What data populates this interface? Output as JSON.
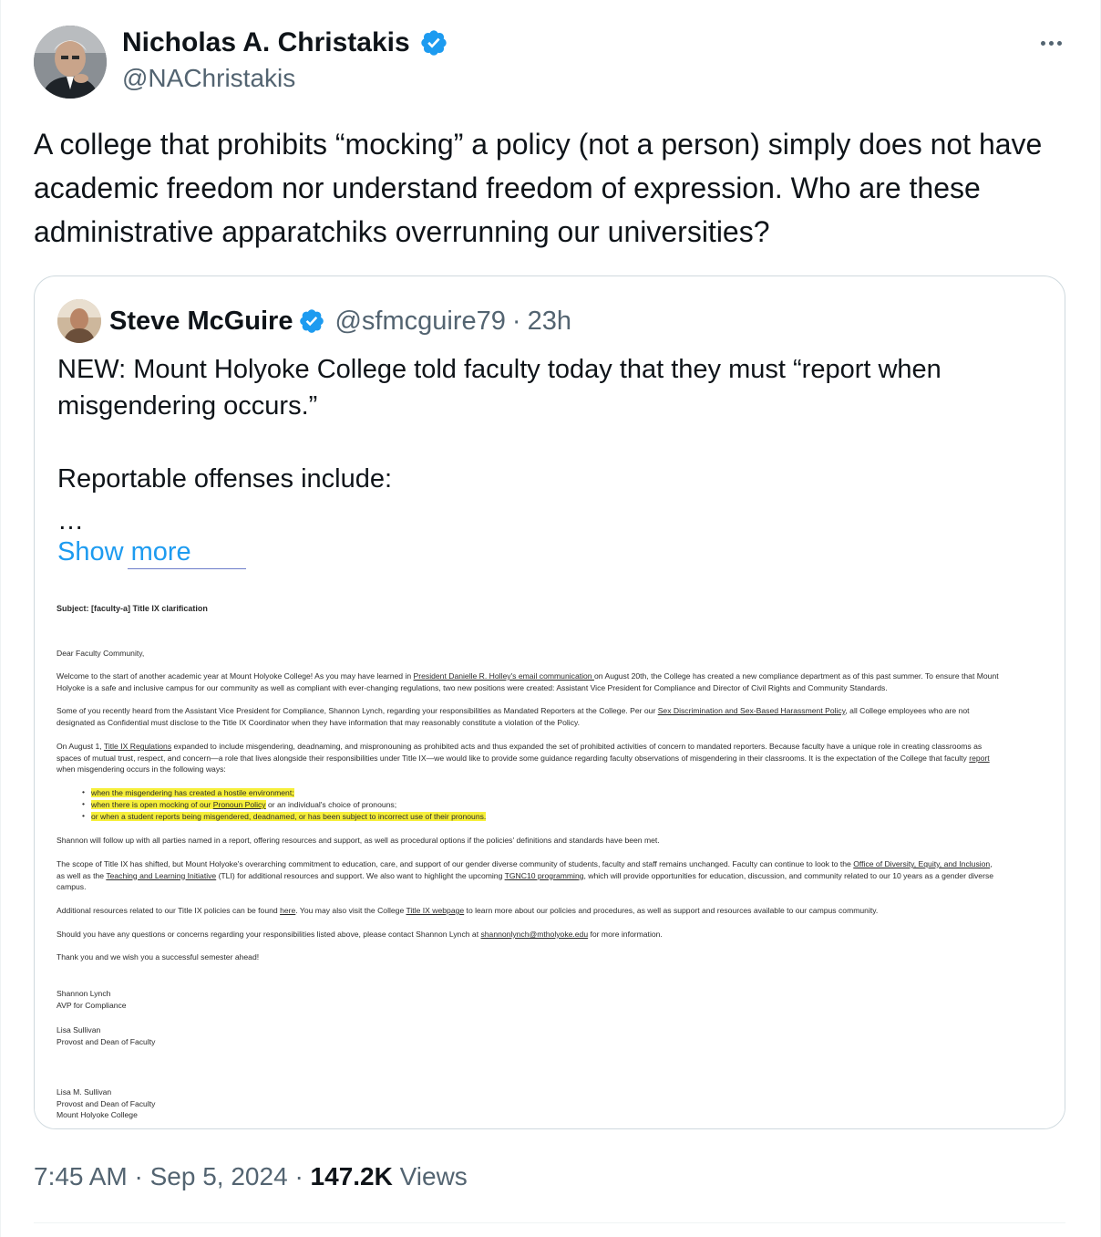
{
  "tweet": {
    "author_name": "Nicholas A. Christakis",
    "author_handle": "@NAChristakis",
    "text": "A college that prohibits “mocking” a policy (not a person) simply does not have academic freedom nor understand freedom of expression. Who are these administrative apparatchiks overrunning our universities?",
    "time": "7:45 AM",
    "date": "Sep 5, 2024",
    "views_count": "147.2K",
    "views_label": "Views",
    "separator": "·"
  },
  "quote": {
    "author_name": "Steve McGuire",
    "author_handle": "@sfmcguire79",
    "time_ago": "23h",
    "line1": "NEW: Mount Holyoke College told faculty today that they must “report when misgendering occurs.”",
    "line2": "Reportable offenses include:",
    "ellipsis": "…",
    "show_more": "Show more"
  },
  "document": {
    "subject": "Subject: [faculty-a] Title IX clarification",
    "greeting": "Dear Faculty Community,",
    "p1a": "Welcome to the start of another academic year at Mount Holyoke College! As you may have learned in ",
    "p1_link": "President Danielle R. Holley's email communication ",
    "p1b": "on August 20th, the College has created a new compliance department as of this past summer. To ensure that Mount",
    "p1c": "Holyoke is a safe and inclusive campus for our community as well as compliant with ever-changing regulations, two new positions were created: Assistant Vice President for Compliance and Director of Civil Rights and Community Standards.",
    "p2a": "Some of you recently heard from the Assistant Vice President for Compliance, Shannon Lynch, regarding your responsibilities as Mandated Reporters at the College. Per our ",
    "p2_link": "Sex Discrimination and Sex-Based Harassment Policy",
    "p2b": ", all College employees who are not",
    "p2c": "designated as Confidential must disclose to the Title IX Coordinator when they have information that may reasonably constitute a violation of the Policy.",
    "p3a": "On August 1, ",
    "p3_link": "Title IX Regulations",
    "p3b": " expanded to include misgendering, deadnaming, and mispronouning as prohibited acts and thus expanded the set of prohibited activities of concern to mandated reporters. Because faculty have a unique role in creating classrooms as",
    "p3c": "spaces of mutual trust, respect, and concern—a role that lives alongside their responsibilities under Title IX—we would like to provide some guidance regarding faculty observations of misgendering in their classrooms. It is the expectation of the College that faculty ",
    "p3_link2": "report",
    "p3d": "when misgendering occurs in the following ways:",
    "bullet1": "when the misgendering has created a hostile environment;",
    "bullet2a": "when there is open mocking of our ",
    "bullet2_link": "Pronoun Policy",
    "bullet2b": " or an individual's choice of pronouns;",
    "bullet3": "or when a student reports being misgendered, deadnamed, or has been subject to incorrect use of their pronouns.",
    "p4": "Shannon will follow up with all parties named in a report, offering resources and support, as well as procedural options if the policies' definitions and standards have been met.",
    "p5a": "The scope of Title IX has shifted, but Mount Holyoke's overarching commitment to education, care, and support of our gender diverse community of students, faculty and staff remains unchanged. Faculty can continue to look to the ",
    "p5_link": "Office of Diversity, Equity, and Inclusion",
    "p5b": ",",
    "p5c": "as well as the ",
    "p5_link2": "Teaching and Learning Initiative",
    "p5d": " (TLI) for additional resources and support. We also want to highlight the upcoming ",
    "p5_link3": "TGNC10 programming",
    "p5e": ", which will provide opportunities for education, discussion, and community related to our 10 years as a gender diverse",
    "p5f": "campus.",
    "p6a": "Additional resources related to our Title IX policies can be found ",
    "p6_link": "here",
    "p6b": ". You may also visit the College ",
    "p6_link2": "Title IX webpage",
    "p6c": " to learn more about our policies and procedures, as well as support and resources available to our campus community.",
    "p7a": "Should you have any questions or concerns regarding your responsibilities listed above, please contact Shannon Lynch at ",
    "p7_link": "shannonlynch@mtholyoke.edu",
    "p7b": " for more information.",
    "p8": "Thank you and we wish you a successful semester ahead!",
    "sig1_name": "Shannon Lynch",
    "sig1_title": "AVP for Compliance",
    "sig2_name": "Lisa Sullivan",
    "sig2_title": "Provost and Dean of Faculty",
    "sig3_name": "Lisa M. Sullivan",
    "sig3_title": "Provost and Dean of Faculty",
    "sig3_org": "Mount Holyoke College"
  },
  "colors": {
    "link_blue": "#1d9bf0",
    "verified_blue": "#1d9bf0",
    "highlight_yellow": "#f6ef3a",
    "secondary_text": "#536471"
  },
  "icons": [
    "verified-badge-icon",
    "more-options-icon"
  ]
}
